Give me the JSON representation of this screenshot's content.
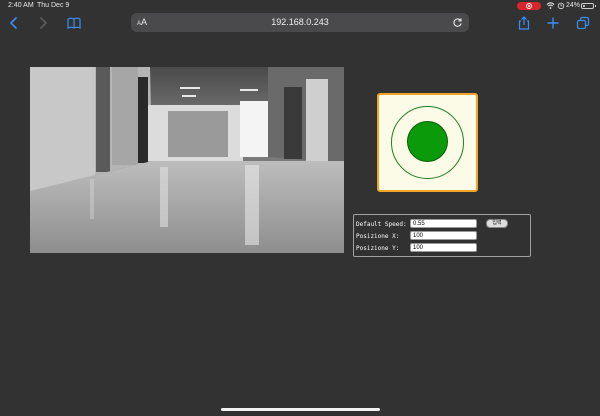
{
  "status_bar": {
    "time": "2:40 AM",
    "date": "Thu Dec 9",
    "battery": "24%",
    "battery_level": 0.24,
    "recording_color": "#d8262d"
  },
  "toolbar": {
    "text_size_label_small": "A",
    "text_size_label_large": "A",
    "url": "192.168.0.243",
    "icons": [
      "back-icon",
      "forward-icon",
      "bookmarks-icon",
      "reload-icon",
      "share-icon",
      "new-tab-icon",
      "tabs-icon"
    ]
  },
  "joystick": {
    "ring_color": "#1e7d1e",
    "knob_color": "#0a9a0a",
    "border_color": "#f0a428"
  },
  "controls": {
    "speed_label": "Default Speed:",
    "speed_value": "0.55",
    "submit_label": "입력",
    "pos_x_label": "Posizione X:",
    "pos_x_value": "100",
    "pos_y_label": "Posizione Y:",
    "pos_y_value": "100"
  }
}
